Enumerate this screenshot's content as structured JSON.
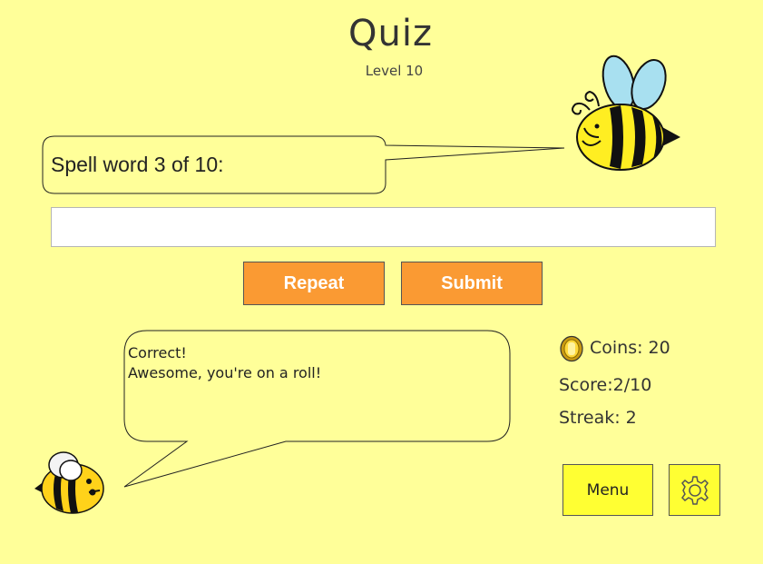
{
  "header": {
    "title": "Quiz",
    "subtitle": "Level 10"
  },
  "prompt": {
    "text": "Spell word 3 of 10:"
  },
  "answer": {
    "value": "",
    "placeholder": ""
  },
  "buttons": {
    "repeat": "Repeat",
    "submit": "Submit",
    "menu": "Menu"
  },
  "feedback": {
    "line1": "Correct!",
    "line2": "Awesome, you're on a roll!"
  },
  "stats": {
    "coins": "Coins: 20",
    "score": "Score:2/10",
    "streak": "Streak: 2"
  },
  "icons": {
    "bee_top": "bee-icon",
    "bee_bottom": "bee-icon",
    "coin": "coin-icon",
    "settings": "gear-icon"
  },
  "colors": {
    "background": "#ffff99",
    "button_orange": "#fa9a33",
    "button_yellow": "#ffff33",
    "bubble": "#ffff99"
  }
}
